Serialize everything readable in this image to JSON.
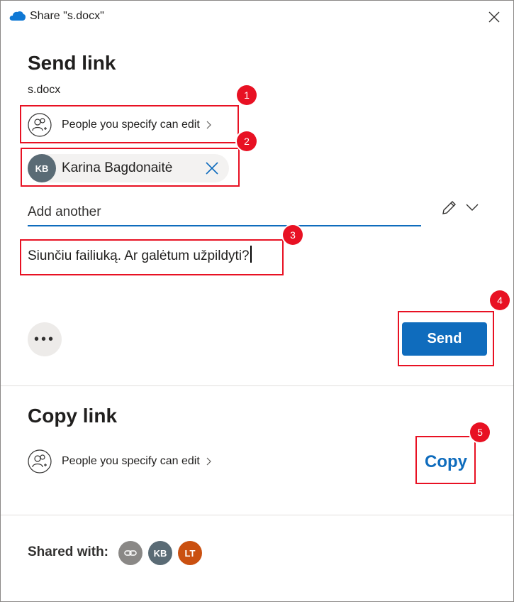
{
  "window": {
    "title": "Share \"s.docx\""
  },
  "send_link": {
    "heading": "Send link",
    "filename": "s.docx",
    "permission": "People you specify can edit",
    "recipient": {
      "initials": "KB",
      "name": "Karina Bagdonaitė"
    },
    "add_another_placeholder": "Add another",
    "message": "Siunčiu failiuką. Ar galėtum užpildyti?",
    "more_label": "•••",
    "send_label": "Send"
  },
  "copy_link": {
    "heading": "Copy link",
    "permission": "People you specify can edit",
    "copy_label": "Copy"
  },
  "shared_with": {
    "label": "Shared with:",
    "avatars": [
      {
        "initials": "",
        "icon": "link-icon",
        "color": "#8a8886"
      },
      {
        "initials": "KB",
        "color": "#5a6b75"
      },
      {
        "initials": "LT",
        "color": "#ca5010"
      }
    ]
  },
  "annotations": [
    "1",
    "2",
    "3",
    "4",
    "5"
  ],
  "colors": {
    "accent": "#0f6cbd",
    "annotation": "#e81123"
  }
}
